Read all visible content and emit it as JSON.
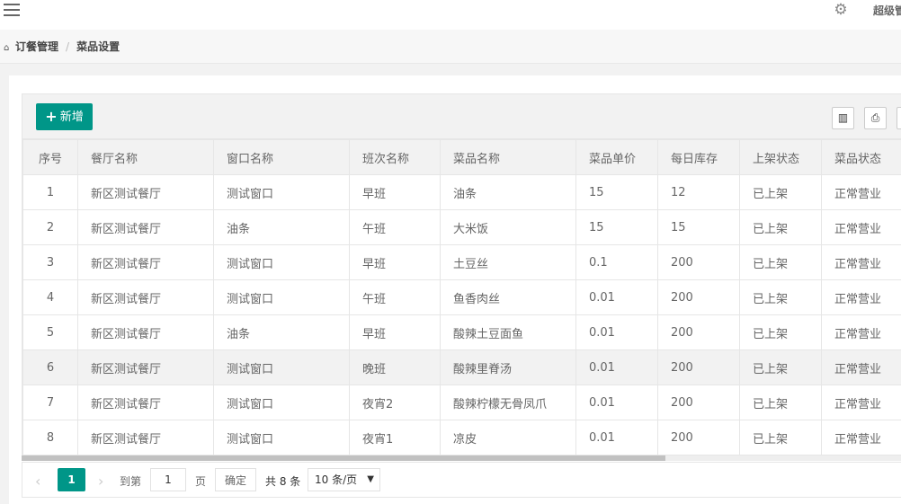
{
  "header": {
    "admin_label": "超级管理员"
  },
  "breadcrumb": {
    "items": [
      "订餐管理",
      "菜品设置"
    ],
    "separator": "/"
  },
  "toolbar": {
    "add_label": "新增",
    "add_icon": "plus-icon",
    "tools": [
      "columns-icon",
      "print-icon",
      "export-icon"
    ]
  },
  "table": {
    "columns": [
      "序号",
      "餐厅名称",
      "窗口名称",
      "班次名称",
      "菜品名称",
      "菜品单价",
      "每日库存",
      "上架状态",
      "菜品状态"
    ],
    "rows": [
      [
        "1",
        "新区测试餐厅",
        "测试窗口",
        "早班",
        "油条",
        "15",
        "12",
        "已上架",
        "正常营业"
      ],
      [
        "2",
        "新区测试餐厅",
        "油条",
        "午班",
        "大米饭",
        "15",
        "15",
        "已上架",
        "正常营业"
      ],
      [
        "3",
        "新区测试餐厅",
        "测试窗口",
        "早班",
        "土豆丝",
        "0.1",
        "200",
        "已上架",
        "正常营业"
      ],
      [
        "4",
        "新区测试餐厅",
        "测试窗口",
        "午班",
        "鱼香肉丝",
        "0.01",
        "200",
        "已上架",
        "正常营业"
      ],
      [
        "5",
        "新区测试餐厅",
        "油条",
        "早班",
        "酸辣土豆面鱼",
        "0.01",
        "200",
        "已上架",
        "正常营业"
      ],
      [
        "6",
        "新区测试餐厅",
        "测试窗口",
        "晚班",
        "酸辣里脊汤",
        "0.01",
        "200",
        "已上架",
        "正常营业"
      ],
      [
        "7",
        "新区测试餐厅",
        "测试窗口",
        "夜宵2",
        "酸辣柠檬无骨凤爪",
        "0.01",
        "200",
        "已上架",
        "正常营业"
      ],
      [
        "8",
        "新区测试餐厅",
        "测试窗口",
        "夜宵1",
        "凉皮",
        "0.01",
        "200",
        "已上架",
        "正常营业"
      ]
    ],
    "highlighted_row": 5
  },
  "pager": {
    "current_page": "1",
    "goto_label": "到第",
    "goto_value": "1",
    "page_unit": "页",
    "confirm_label": "确定",
    "total_label": "共 8 条",
    "limit_label": "10 条/页"
  },
  "colors": {
    "accent": "#009688"
  }
}
